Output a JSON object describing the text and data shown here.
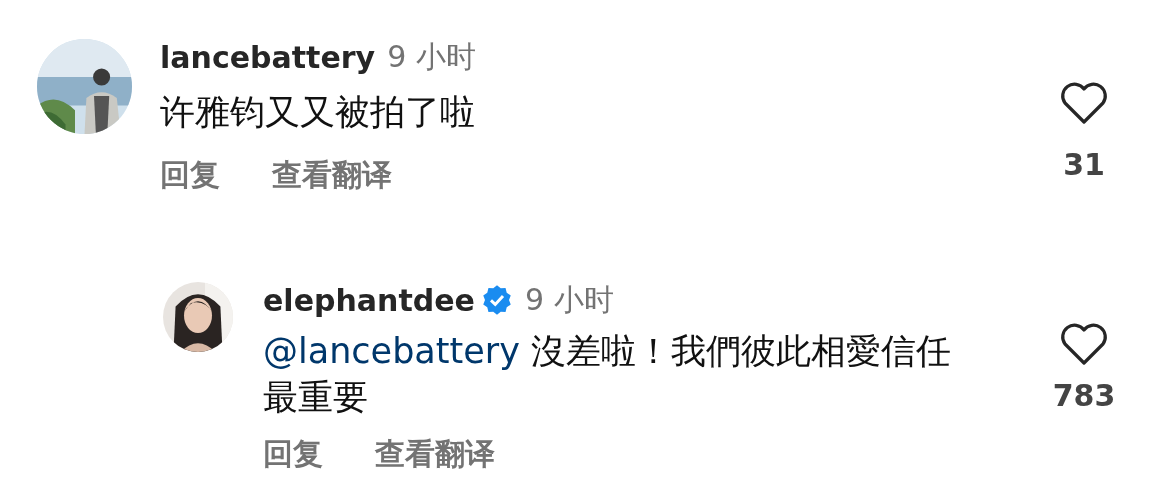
{
  "comments": [
    {
      "user": "lancebattery",
      "verified": false,
      "time": "9 小时",
      "text": "许雅钧又又被拍了啦",
      "actions": [
        "回复",
        "查看翻译"
      ],
      "likes": "31",
      "avatar": {
        "kind": "picture"
      },
      "replies": [
        {
          "user": "elephantdee",
          "verified": true,
          "time": "9 小时",
          "mention": "@lancebattery",
          "text": "沒差啦！我們彼此相愛信任最重要",
          "actions": [
            "回复",
            "查看翻译"
          ],
          "likes": "783",
          "avatar": {
            "kind": "picture"
          }
        }
      ]
    }
  ]
}
